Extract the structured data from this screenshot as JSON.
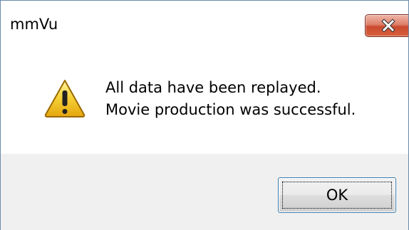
{
  "window": {
    "title": "mmVu"
  },
  "titlebar": {
    "close_icon": "close-icon",
    "close_color": "#c94a2e"
  },
  "dialog": {
    "icon": "warning-icon",
    "message_lines": [
      "All data have been replayed.",
      "Movie production was successful."
    ],
    "ok_label": "OK"
  },
  "colors": {
    "client_background": "#ffffff",
    "footer_background": "#f0f0f0",
    "ok_border": "#3c7fb1"
  }
}
